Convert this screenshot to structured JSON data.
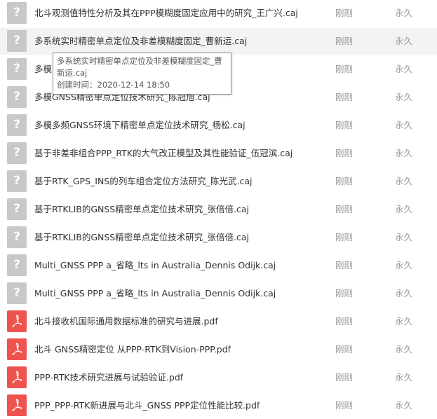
{
  "rows": [
    {
      "icon": "unknown-file-icon",
      "name": "北斗观测值特性分析及其在PPP模糊度固定应用中的研究_王广兴.caj",
      "time": "刚刚",
      "expiry": "永久",
      "highlight": false
    },
    {
      "icon": "unknown-file-icon",
      "name": "多系统实时精密单点定位及非差模糊度固定_曹新运.caj",
      "time": "刚刚",
      "expiry": "永久",
      "highlight": true
    },
    {
      "icon": "unknown-file-icon",
      "name": "多模",
      "time": "刚刚",
      "expiry": "永久",
      "highlight": false
    },
    {
      "icon": "unknown-file-icon",
      "name": "多模GNSS精密单点定位技术研究_陈冠旭.caj",
      "time": "刚刚",
      "expiry": "永久",
      "highlight": false
    },
    {
      "icon": "unknown-file-icon",
      "name": "多模多频GNSS环境下精密单点定位技术研究_杨松.caj",
      "time": "刚刚",
      "expiry": "永久",
      "highlight": false
    },
    {
      "icon": "unknown-file-icon",
      "name": "基于非差非组合PPP_RTK的大气改正模型及其性能验证_伍冠滨.caj",
      "time": "刚刚",
      "expiry": "永久",
      "highlight": false
    },
    {
      "icon": "unknown-file-icon",
      "name": "基于RTK_GPS_INS的列车组合定位方法研究_陈光武.caj",
      "time": "刚刚",
      "expiry": "永久",
      "highlight": false
    },
    {
      "icon": "unknown-file-icon",
      "name": "基于RTKLIB的GNSS精密单点定位技术研究_张倍倍.caj",
      "time": "刚刚",
      "expiry": "永久",
      "highlight": false
    },
    {
      "icon": "unknown-file-icon",
      "name": "基于RTKLIB的GNSS精密单点定位技术研究_张倍倍.caj",
      "time": "刚刚",
      "expiry": "永久",
      "highlight": false
    },
    {
      "icon": "unknown-file-icon",
      "name": "Multi_GNSS PPP a_省略_lts in Australia_Dennis Odijk.caj",
      "time": "刚刚",
      "expiry": "永久",
      "highlight": false
    },
    {
      "icon": "unknown-file-icon",
      "name": "Multi_GNSS PPP a_省略_lts in Australia_Dennis Odijk.caj",
      "time": "刚刚",
      "expiry": "永久",
      "highlight": false
    },
    {
      "icon": "pdf-file-icon",
      "name": "北斗接收机国际通用数据标准的研究与进展.pdf",
      "time": "刚刚",
      "expiry": "永久",
      "highlight": false
    },
    {
      "icon": "pdf-file-icon",
      "name": "北斗 GNSS精密定位 从PPP-RTK到Vision-PPP.pdf",
      "time": "刚刚",
      "expiry": "永久",
      "highlight": false
    },
    {
      "icon": "pdf-file-icon",
      "name": "PPP-RTK技术研究进展与试验验证.pdf",
      "time": "刚刚",
      "expiry": "永久",
      "highlight": false
    },
    {
      "icon": "pdf-file-icon",
      "name": "PPP_PPP-RTK新进展与北斗_GNSS PPP定位性能比较.pdf",
      "time": "刚刚",
      "expiry": "永久",
      "highlight": false
    }
  ],
  "tooltip": {
    "name": "多系统实时精密单点定位及非差模糊度固定_曹新运.caj",
    "created": "创建时间：2020-12-14 18:50"
  },
  "colors": {
    "pdf_icon": "#ef5350",
    "unknown_icon": "#c8c8c8",
    "highlight_row": "#f3f3f3",
    "muted_text": "#999999"
  }
}
